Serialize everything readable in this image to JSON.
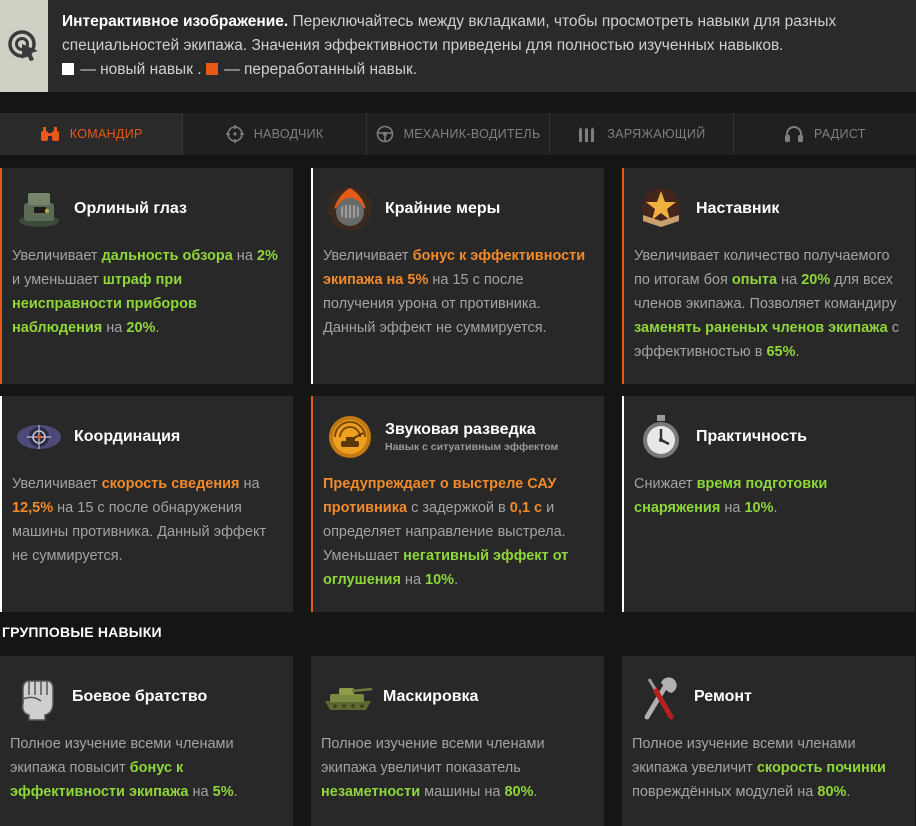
{
  "banner": {
    "title": "Интерактивное изображение.",
    "text": " Переключайтесь между вкладками, чтобы просмотреть навыки для разных специальностей экипажа. Значения эффективности приведены для полностью изученных навыков.",
    "legend_new": "— новый навык .",
    "legend_reworked": "— переработанный навык.",
    "colors": {
      "new": "#ffffff",
      "reworked": "#e45a16"
    }
  },
  "tabs": [
    {
      "label": "КОМАНДИР",
      "icon": "binoculars-icon",
      "active": true
    },
    {
      "label": "НАВОДЧИК",
      "icon": "crosshair-icon",
      "active": false
    },
    {
      "label": "МЕХАНИК-ВОДИТЕЛЬ",
      "icon": "steering-wheel-icon",
      "active": false
    },
    {
      "label": "ЗАРЯЖАЮЩИЙ",
      "icon": "shells-icon",
      "active": false
    },
    {
      "label": "РАДИСТ",
      "icon": "headphones-icon",
      "active": false
    }
  ],
  "skills": [
    {
      "title": "Орлиный глаз",
      "icon": "periscope-icon",
      "status": "reworked",
      "desc": [
        {
          "t": "Увеличивает "
        },
        {
          "t": "дальность обзора",
          "c": "g"
        },
        {
          "t": " на "
        },
        {
          "t": "2%",
          "c": "g"
        },
        {
          "t": " и уменьшает "
        },
        {
          "t": "штраф при неисправности приборов наблюдения",
          "c": "g"
        },
        {
          "t": " на "
        },
        {
          "t": "20%",
          "c": "g"
        },
        {
          "t": "."
        }
      ]
    },
    {
      "title": "Крайние меры",
      "icon": "fist-fire-icon",
      "status": "new",
      "desc": [
        {
          "t": "Увеличивает "
        },
        {
          "t": "бонус к эффективности экипажа на 5%",
          "c": "o"
        },
        {
          "t": " на 15 с после получения урона от противника. Данный эффект не суммируется."
        }
      ]
    },
    {
      "title": "Наставник",
      "icon": "star-book-icon",
      "status": "reworked",
      "desc": [
        {
          "t": "Увеличивает количество получаемого по итогам боя "
        },
        {
          "t": "опыта",
          "c": "g"
        },
        {
          "t": " на "
        },
        {
          "t": "20%",
          "c": "g"
        },
        {
          "t": " для всех членов экипажа. Позволяет командиру "
        },
        {
          "t": "заменять раненых членов экипажа",
          "c": "g"
        },
        {
          "t": " с эффективностью в "
        },
        {
          "t": "65%",
          "c": "g"
        },
        {
          "t": "."
        }
      ]
    },
    {
      "title": "Координация",
      "icon": "target-eye-icon",
      "status": "new",
      "desc": [
        {
          "t": "Увеличивает "
        },
        {
          "t": "скорость сведения",
          "c": "o"
        },
        {
          "t": " на "
        },
        {
          "t": "12,5%",
          "c": "o"
        },
        {
          "t": " на 15 с после обнаружения машины противника. Данный эффект не суммируется."
        }
      ]
    },
    {
      "title": "Звуковая разведка",
      "subtitle": "Навык с ситуативным эффектом",
      "icon": "radar-tank-icon",
      "status": "reworked",
      "desc": [
        {
          "t": "Предупреждает о выстреле САУ противника",
          "c": "o"
        },
        {
          "t": " с задержкой в "
        },
        {
          "t": "0,1 с",
          "c": "o"
        },
        {
          "t": " и определяет направление выстрела. Уменьшает "
        },
        {
          "t": "негативный эффект от оглушения",
          "c": "g"
        },
        {
          "t": " на "
        },
        {
          "t": "10%",
          "c": "g"
        },
        {
          "t": "."
        }
      ]
    },
    {
      "title": "Практичность",
      "icon": "stopwatch-gear-icon",
      "status": "new",
      "desc": [
        {
          "t": "Снижает "
        },
        {
          "t": "время подготовки снаряжения",
          "c": "g"
        },
        {
          "t": " на "
        },
        {
          "t": "10%",
          "c": "g"
        },
        {
          "t": "."
        }
      ]
    }
  ],
  "group_title": "ГРУППОВЫЕ НАВЫКИ",
  "group_skills": [
    {
      "title": "Боевое братство",
      "icon": "fist-icon",
      "desc": [
        {
          "t": "Полное изучение всеми членами экипажа повысит "
        },
        {
          "t": "бонус к эффективности экипажа",
          "c": "g"
        },
        {
          "t": " на "
        },
        {
          "t": "5%",
          "c": "g"
        },
        {
          "t": "."
        }
      ]
    },
    {
      "title": "Маскировка",
      "icon": "camo-tank-icon",
      "desc": [
        {
          "t": "Полное изучение всеми членами экипажа увеличит показатель "
        },
        {
          "t": "незаметности",
          "c": "g"
        },
        {
          "t": " машины на "
        },
        {
          "t": "80%",
          "c": "g"
        },
        {
          "t": "."
        }
      ]
    },
    {
      "title": "Ремонт",
      "icon": "wrench-screwdriver-icon",
      "desc": [
        {
          "t": "Полное изучение всеми членами экипажа увеличит "
        },
        {
          "t": "скорость починки",
          "c": "g"
        },
        {
          "t": " повреждённых модулей на "
        },
        {
          "t": "80%",
          "c": "g"
        },
        {
          "t": "."
        }
      ]
    }
  ]
}
